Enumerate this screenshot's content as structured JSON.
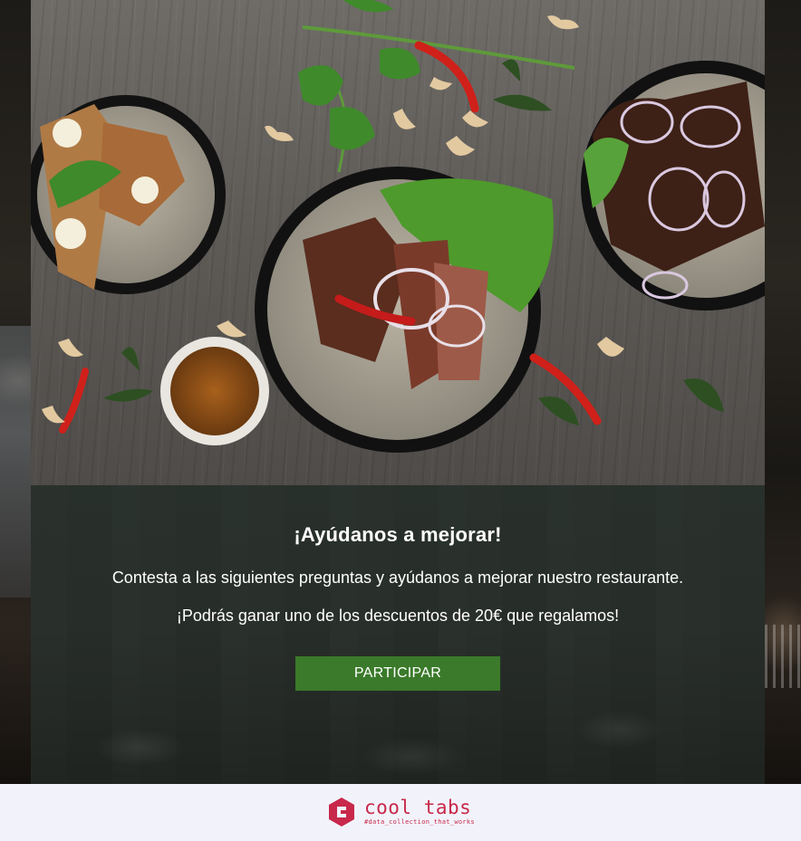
{
  "survey": {
    "title": "¡Ayúdanos a mejorar!",
    "description_line1": "Contesta a las siguientes preguntas y ayúdanos a mejorar nuestro restaurante.",
    "description_line2": "¡Podrás ganar uno de los descuentos de 20€ que regalamos!",
    "cta_label": "PARTICIPAR"
  },
  "branding": {
    "name": "cool tabs",
    "tagline": "#data_collection_that_works",
    "icon": "coolt-tabs-hexagon-logo-icon"
  },
  "colors": {
    "button": "#3a7a2a",
    "brand": "#c8284a",
    "footer_bg": "#f2f3fa"
  }
}
